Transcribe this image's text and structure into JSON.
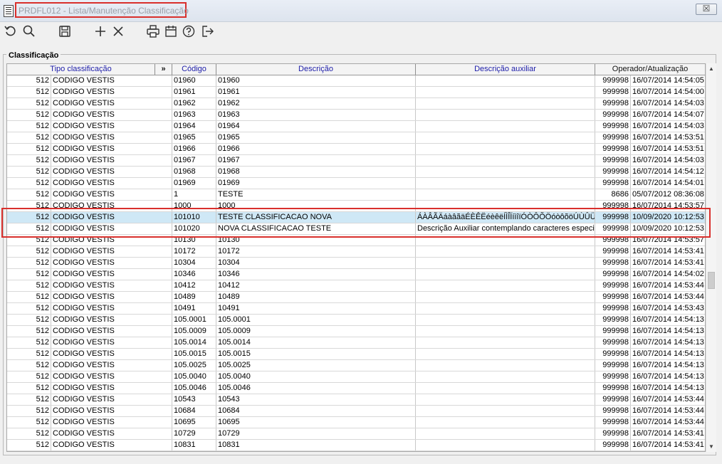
{
  "window": {
    "title": "PRDFL012 - Lista/Manutenção Classificação",
    "close_label": "☒"
  },
  "toolbar": {
    "icons": [
      "refresh-icon",
      "search-icon",
      "save-icon",
      "add-icon",
      "delete-icon",
      "print-icon",
      "calendar-icon",
      "help-icon",
      "exit-icon"
    ]
  },
  "panel": {
    "title": "Classificação"
  },
  "table": {
    "headers": {
      "tipo": "Tipo classificação",
      "expand": "»",
      "codigo": "Código",
      "descricao": "Descrição",
      "aux": "Descrição auxiliar",
      "operador": "Operador/Atualização"
    },
    "rows": [
      {
        "n": "512",
        "tipo": "CODIGO VESTIS",
        "codigo": "01960",
        "desc": "01960",
        "aux": "",
        "op": "999998",
        "dt": "16/07/2014 14:54:05"
      },
      {
        "n": "512",
        "tipo": "CODIGO VESTIS",
        "codigo": "01961",
        "desc": "01961",
        "aux": "",
        "op": "999998",
        "dt": "16/07/2014 14:54:00"
      },
      {
        "n": "512",
        "tipo": "CODIGO VESTIS",
        "codigo": "01962",
        "desc": "01962",
        "aux": "",
        "op": "999998",
        "dt": "16/07/2014 14:54:03"
      },
      {
        "n": "512",
        "tipo": "CODIGO VESTIS",
        "codigo": "01963",
        "desc": "01963",
        "aux": "",
        "op": "999998",
        "dt": "16/07/2014 14:54:07"
      },
      {
        "n": "512",
        "tipo": "CODIGO VESTIS",
        "codigo": "01964",
        "desc": "01964",
        "aux": "",
        "op": "999998",
        "dt": "16/07/2014 14:54:03"
      },
      {
        "n": "512",
        "tipo": "CODIGO VESTIS",
        "codigo": "01965",
        "desc": "01965",
        "aux": "",
        "op": "999998",
        "dt": "16/07/2014 14:53:51"
      },
      {
        "n": "512",
        "tipo": "CODIGO VESTIS",
        "codigo": "01966",
        "desc": "01966",
        "aux": "",
        "op": "999998",
        "dt": "16/07/2014 14:53:51"
      },
      {
        "n": "512",
        "tipo": "CODIGO VESTIS",
        "codigo": "01967",
        "desc": "01967",
        "aux": "",
        "op": "999998",
        "dt": "16/07/2014 14:54:03"
      },
      {
        "n": "512",
        "tipo": "CODIGO VESTIS",
        "codigo": "01968",
        "desc": "01968",
        "aux": "",
        "op": "999998",
        "dt": "16/07/2014 14:54:12"
      },
      {
        "n": "512",
        "tipo": "CODIGO VESTIS",
        "codigo": "01969",
        "desc": "01969",
        "aux": "",
        "op": "999998",
        "dt": "16/07/2014 14:54:01"
      },
      {
        "n": "512",
        "tipo": "CODIGO VESTIS",
        "codigo": "1",
        "desc": "TESTE",
        "aux": "",
        "op": "8686",
        "dt": "05/07/2012 08:36:08"
      },
      {
        "n": "512",
        "tipo": "CODIGO VESTIS",
        "codigo": "1000",
        "desc": "1000",
        "aux": "",
        "op": "999998",
        "dt": "16/07/2014 14:53:57"
      },
      {
        "n": "512",
        "tipo": "CODIGO VESTIS",
        "codigo": "101010",
        "desc": "TESTE CLASSIFICACAO NOVA",
        "aux": "ÁÀÂÃÄáàâãäÉÈÊËéèêëÍÌÎÏíìîïÓÒÔÕÖóòôõöÚÙÛÜúùûü",
        "op": "999998",
        "dt": "10/09/2020 10:12:53",
        "selected": true
      },
      {
        "n": "512",
        "tipo": "CODIGO VESTIS",
        "codigo": "101020",
        "desc": "NOVA CLASSIFICACAO TESTE",
        "aux": "Descrição Auxiliar contemplando caracteres especiais",
        "op": "999998",
        "dt": "10/09/2020 10:12:53"
      },
      {
        "n": "512",
        "tipo": "CODIGO VESTIS",
        "codigo": "10130",
        "desc": "10130",
        "aux": "",
        "op": "999998",
        "dt": "16/07/2014 14:53:57"
      },
      {
        "n": "512",
        "tipo": "CODIGO VESTIS",
        "codigo": "10172",
        "desc": "10172",
        "aux": "",
        "op": "999998",
        "dt": "16/07/2014 14:53:41"
      },
      {
        "n": "512",
        "tipo": "CODIGO VESTIS",
        "codigo": "10304",
        "desc": "10304",
        "aux": "",
        "op": "999998",
        "dt": "16/07/2014 14:53:41"
      },
      {
        "n": "512",
        "tipo": "CODIGO VESTIS",
        "codigo": "10346",
        "desc": "10346",
        "aux": "",
        "op": "999998",
        "dt": "16/07/2014 14:54:02"
      },
      {
        "n": "512",
        "tipo": "CODIGO VESTIS",
        "codigo": "10412",
        "desc": "10412",
        "aux": "",
        "op": "999998",
        "dt": "16/07/2014 14:53:44"
      },
      {
        "n": "512",
        "tipo": "CODIGO VESTIS",
        "codigo": "10489",
        "desc": "10489",
        "aux": "",
        "op": "999998",
        "dt": "16/07/2014 14:53:44"
      },
      {
        "n": "512",
        "tipo": "CODIGO VESTIS",
        "codigo": "10491",
        "desc": "10491",
        "aux": "",
        "op": "999998",
        "dt": "16/07/2014 14:53:43"
      },
      {
        "n": "512",
        "tipo": "CODIGO VESTIS",
        "codigo": "105.0001",
        "desc": "105.0001",
        "aux": "",
        "op": "999998",
        "dt": "16/07/2014 14:54:13"
      },
      {
        "n": "512",
        "tipo": "CODIGO VESTIS",
        "codigo": "105.0009",
        "desc": "105.0009",
        "aux": "",
        "op": "999998",
        "dt": "16/07/2014 14:54:13"
      },
      {
        "n": "512",
        "tipo": "CODIGO VESTIS",
        "codigo": "105.0014",
        "desc": "105.0014",
        "aux": "",
        "op": "999998",
        "dt": "16/07/2014 14:54:13"
      },
      {
        "n": "512",
        "tipo": "CODIGO VESTIS",
        "codigo": "105.0015",
        "desc": "105.0015",
        "aux": "",
        "op": "999998",
        "dt": "16/07/2014 14:54:13"
      },
      {
        "n": "512",
        "tipo": "CODIGO VESTIS",
        "codigo": "105.0025",
        "desc": "105.0025",
        "aux": "",
        "op": "999998",
        "dt": "16/07/2014 14:54:13"
      },
      {
        "n": "512",
        "tipo": "CODIGO VESTIS",
        "codigo": "105.0040",
        "desc": "105.0040",
        "aux": "",
        "op": "999998",
        "dt": "16/07/2014 14:54:13"
      },
      {
        "n": "512",
        "tipo": "CODIGO VESTIS",
        "codigo": "105.0046",
        "desc": "105.0046",
        "aux": "",
        "op": "999998",
        "dt": "16/07/2014 14:54:13"
      },
      {
        "n": "512",
        "tipo": "CODIGO VESTIS",
        "codigo": "10543",
        "desc": "10543",
        "aux": "",
        "op": "999998",
        "dt": "16/07/2014 14:53:44"
      },
      {
        "n": "512",
        "tipo": "CODIGO VESTIS",
        "codigo": "10684",
        "desc": "10684",
        "aux": "",
        "op": "999998",
        "dt": "16/07/2014 14:53:44"
      },
      {
        "n": "512",
        "tipo": "CODIGO VESTIS",
        "codigo": "10695",
        "desc": "10695",
        "aux": "",
        "op": "999998",
        "dt": "16/07/2014 14:53:44"
      },
      {
        "n": "512",
        "tipo": "CODIGO VESTIS",
        "codigo": "10729",
        "desc": "10729",
        "aux": "",
        "op": "999998",
        "dt": "16/07/2014 14:53:41"
      },
      {
        "n": "512",
        "tipo": "CODIGO VESTIS",
        "codigo": "10831",
        "desc": "10831",
        "aux": "",
        "op": "999998",
        "dt": "16/07/2014 14:53:41"
      }
    ]
  }
}
